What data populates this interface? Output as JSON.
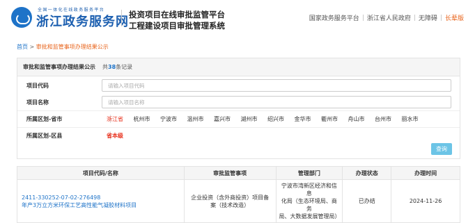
{
  "header": {
    "logo_small": "全国一体化在线政务服务平台",
    "logo_big": "浙江政务服务网",
    "platform_line1": "投资项目在线审批监管平台",
    "platform_line2": "工程建设项目审批管理系统",
    "nav": [
      "国家政务服务平台",
      "浙江省人民政府",
      "无障碍",
      "长辈版"
    ]
  },
  "breadcrumb": {
    "home": "首页",
    "separator": ">",
    "current": "审批和监管事项办理结果公示"
  },
  "panel": {
    "title": "审批和监管事项办理结果公示",
    "count_prefix": "共",
    "count_value": "38",
    "count_suffix": "条记录",
    "fields": {
      "project_code": {
        "label": "项目代码",
        "placeholder": "请输入项目代码"
      },
      "project_name": {
        "label": "项目名称",
        "placeholder": "请输入项目名称"
      },
      "region_city": {
        "label": "所属区划-省市"
      },
      "region_district": {
        "label": "所属区划-区县",
        "selected": "省本级"
      }
    },
    "cities": [
      "浙江省",
      "杭州市",
      "宁波市",
      "温州市",
      "嘉兴市",
      "湖州市",
      "绍兴市",
      "金华市",
      "衢州市",
      "舟山市",
      "台州市",
      "丽水市"
    ],
    "query_label": "查询"
  },
  "table": {
    "headers": [
      "项目代码/名称",
      "审批监管事项",
      "管理部门",
      "办理状态",
      "办理时间"
    ],
    "rows": [
      {
        "code": "2411-330252-07-02-276498",
        "name": "年产3万立方米环保工艺高性能气凝胶材料项目",
        "item_line1": "企业投资（含外商投资）项目备",
        "item_line2": "案（技术改造）",
        "dept_line1": "宁波市湾新区经济和信息",
        "dept_line2": "化局（生态环境局、商务",
        "dept_line3": "局、大数据发展管理局）",
        "status": "已办结",
        "time": "2024-11-26"
      }
    ]
  },
  "colors": {
    "accent": "#1e73c8",
    "active": "#e8301c",
    "orange": "#e8641c",
    "button": "#6cc4e6"
  },
  "icons": [
    "zhejiang-emblem-icon"
  ]
}
